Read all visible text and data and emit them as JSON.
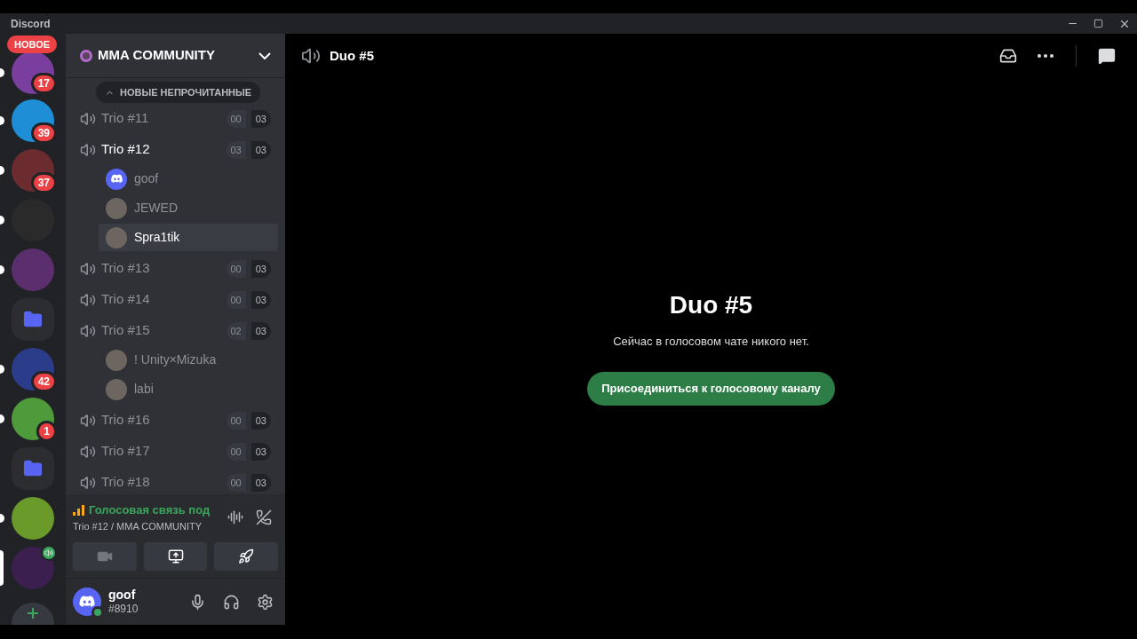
{
  "window": {
    "title": "Discord"
  },
  "servers": [
    {
      "kind": "avatar",
      "color": "#7a3f9e",
      "badge": "17",
      "unread": true,
      "selected": false,
      "label": "НОВОЕ",
      "voice": false
    },
    {
      "kind": "avatar",
      "color": "#1e8fd6",
      "badge": "39",
      "unread": true,
      "selected": false,
      "voice": false
    },
    {
      "kind": "avatar",
      "color": "#6b2b2f",
      "badge": "37",
      "unread": true,
      "selected": false,
      "voice": false
    },
    {
      "kind": "avatar",
      "color": "#2a2a2a",
      "unread": true,
      "selected": false,
      "voice": false
    },
    {
      "kind": "avatar",
      "color": "#5b2e6e",
      "unread": true,
      "selected": false,
      "voice": false
    },
    {
      "kind": "folder",
      "unread": false,
      "selected": false,
      "voice": false
    },
    {
      "kind": "avatar",
      "color": "#2b3c8a",
      "badge": "42",
      "unread": true,
      "selected": false,
      "voice": false
    },
    {
      "kind": "avatar",
      "color": "#4f9a3a",
      "badge": "1",
      "unread": true,
      "selected": false,
      "voice": false
    },
    {
      "kind": "folder",
      "unread": false,
      "selected": false,
      "voice": false
    },
    {
      "kind": "avatar",
      "color": "#6a9a2a",
      "unread": true,
      "selected": false,
      "voice": false
    },
    {
      "kind": "avatar",
      "color": "#3a1f4f",
      "unread": false,
      "selected": true,
      "voice": true
    },
    {
      "kind": "add",
      "unread": false,
      "selected": false,
      "voice": false
    }
  ],
  "server_header": {
    "name": "MMA COMMUNITY"
  },
  "unread_banner": "НОВЫЕ НЕПРОЧИТАННЫЕ",
  "channels": [
    {
      "name": "Trio #11",
      "count": "00",
      "limit": "03",
      "active": false
    },
    {
      "name": "Trio #12",
      "count": "03",
      "limit": "03",
      "active": true,
      "children": [
        {
          "name": "goof",
          "kind": "discord",
          "selected": false
        },
        {
          "name": "JEWED",
          "kind": "photo",
          "selected": false
        },
        {
          "name": "Spra1tik",
          "kind": "photo",
          "selected": true
        }
      ]
    },
    {
      "name": "Trio #13",
      "count": "00",
      "limit": "03",
      "active": false
    },
    {
      "name": "Trio #14",
      "count": "00",
      "limit": "03",
      "active": false
    },
    {
      "name": "Trio #15",
      "count": "02",
      "limit": "03",
      "active": false,
      "children": [
        {
          "name": "! Unity×Mizuka",
          "kind": "photo",
          "selected": false
        },
        {
          "name": "labi",
          "kind": "photo",
          "selected": false
        }
      ]
    },
    {
      "name": "Trio #16",
      "count": "00",
      "limit": "03",
      "active": false
    },
    {
      "name": "Trio #17",
      "count": "00",
      "limit": "03",
      "active": false
    },
    {
      "name": "Trio #18",
      "count": "00",
      "limit": "03",
      "active": false
    }
  ],
  "voice_panel": {
    "status": "Голосовая связь под",
    "location": "Trio #12 / MMA COMMUNITY"
  },
  "user": {
    "name": "goof",
    "tag": "#8910",
    "online": true
  },
  "main": {
    "channel": "Duo #5",
    "title": "Duo #5",
    "message": "Сейчас в голосовом чате никого нет.",
    "button": "Присоединиться к голосовому каналу"
  }
}
